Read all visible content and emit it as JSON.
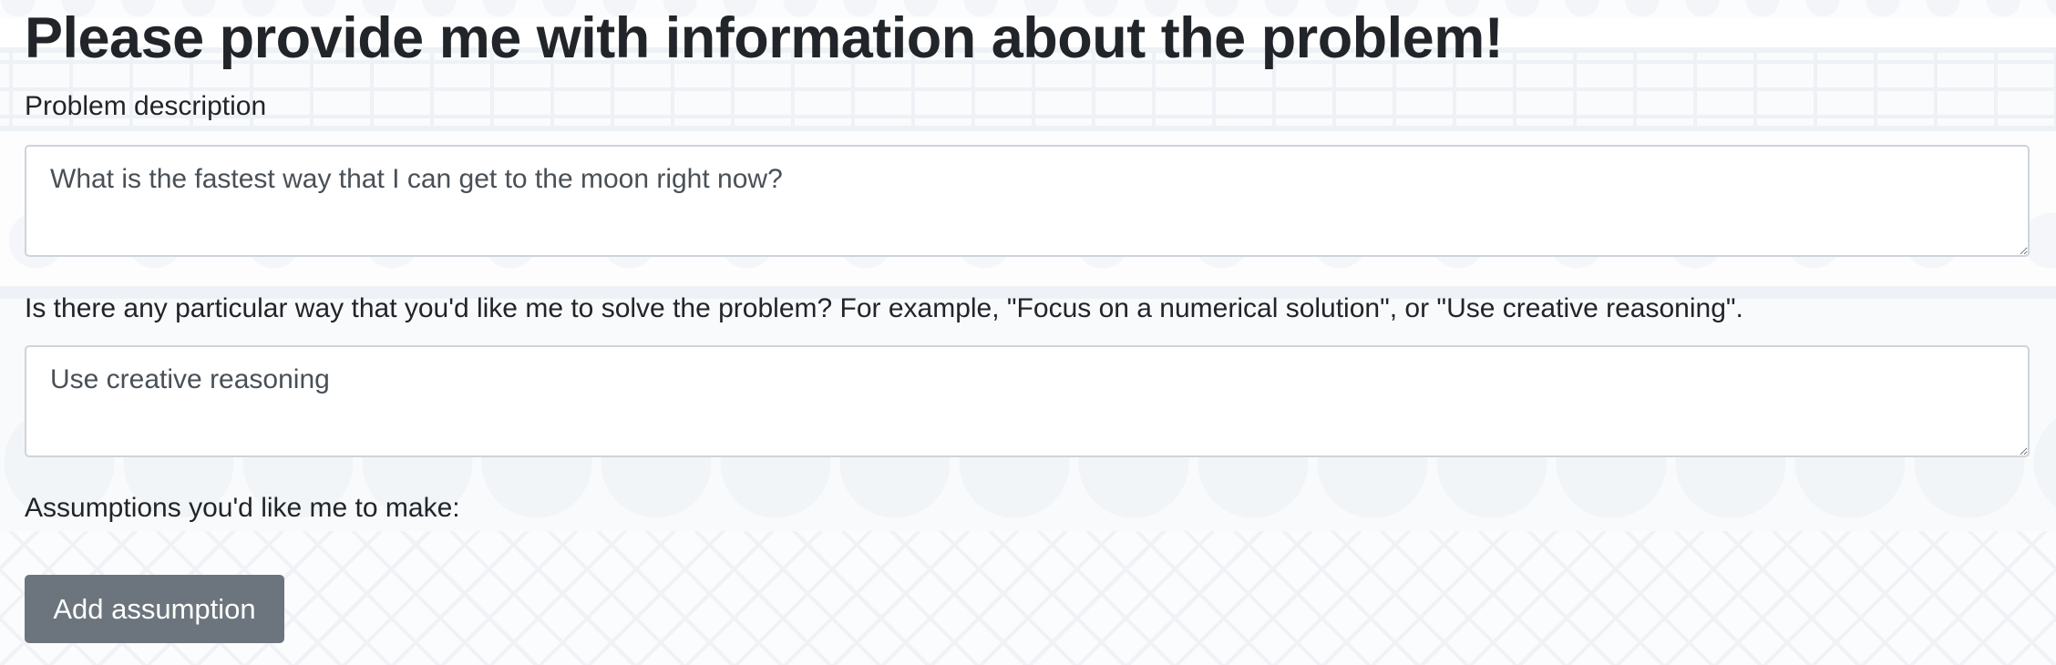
{
  "page": {
    "title": "Please provide me with information about the problem!"
  },
  "form": {
    "problem_description": {
      "label": "Problem description",
      "value": "What is the fastest way that I can get to the moon right now?"
    },
    "solve_method": {
      "label": "Is there any particular way that you'd like me to solve the problem? For example, \"Focus on a numerical solution\", or \"Use creative reasoning\".",
      "value": "Use creative reasoning"
    },
    "assumptions": {
      "label": "Assumptions you'd like me to make:",
      "add_button_label": "Add assumption"
    }
  },
  "colors": {
    "text": "#212529",
    "input_text": "#495057",
    "input_border": "#ced4da",
    "button_bg": "#6c757d",
    "button_text": "#ffffff"
  }
}
